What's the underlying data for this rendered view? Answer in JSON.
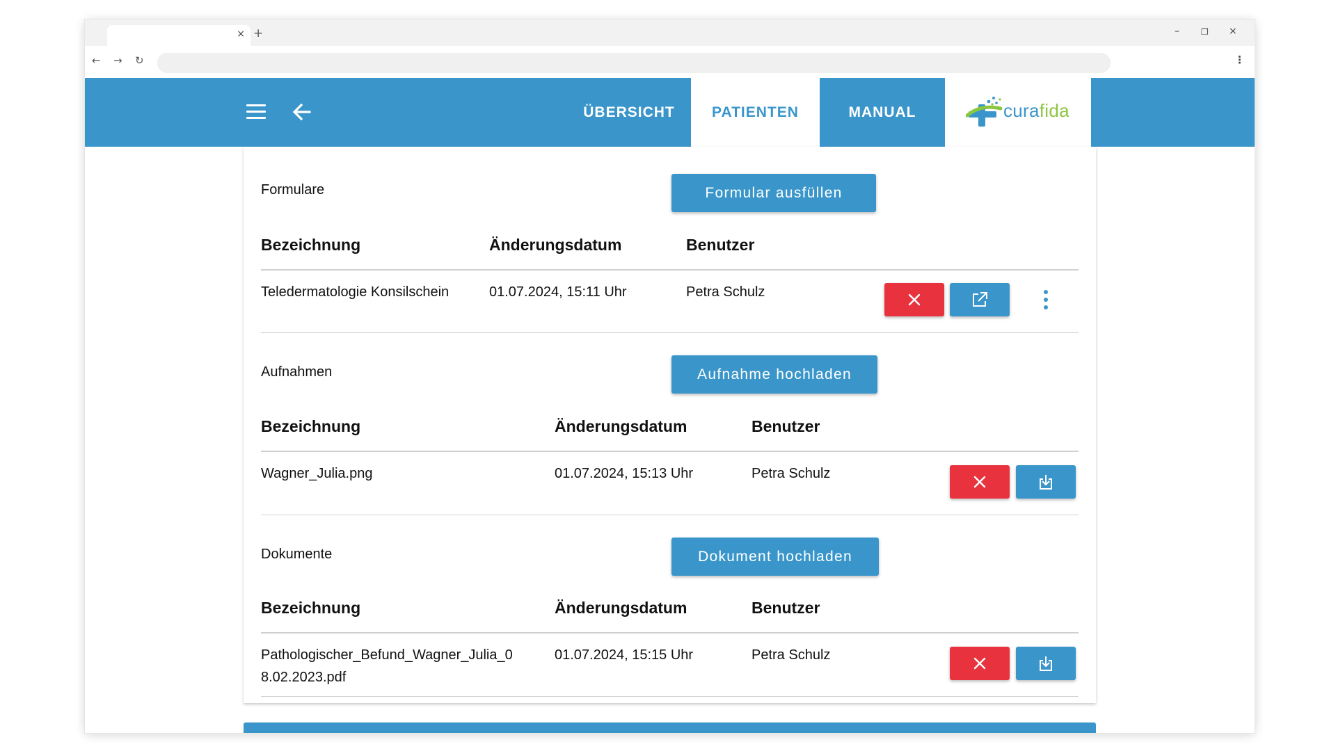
{
  "browser": {
    "tab_close": "×",
    "new_tab": "+",
    "minimize": "–",
    "restore": "❐",
    "close": "×",
    "back": "←",
    "forward": "→",
    "reload": "↻",
    "menu": "⋮",
    "address_value": ""
  },
  "appbar": {
    "nav": {
      "uebersicht": "ÜBERSICHT",
      "patienten": "PATIENTEN",
      "manual": "MANUAL"
    },
    "logo": {
      "part1": "cura",
      "part2": "fida"
    },
    "icons": {
      "menu": "menu-icon",
      "back": "arrow-left-icon"
    }
  },
  "colors": {
    "primary": "#3a96ca",
    "danger": "#e8333f",
    "logo_green": "#8cc63f"
  },
  "sections": {
    "formulare": {
      "label": "Formulare",
      "button": "Formular ausfüllen",
      "headers": [
        "Bezeichnung",
        "Änderungsdatum",
        "Benutzer"
      ],
      "rows": [
        {
          "name": "Teledermatologie Konsilschein",
          "date": "01.07.2024, 15:11 Uhr",
          "user": "Petra Schulz"
        }
      ]
    },
    "aufnahmen": {
      "label": "Aufnahmen",
      "button": "Aufnahme hochladen",
      "headers": [
        "Bezeichnung",
        "Änderungsdatum",
        "Benutzer"
      ],
      "rows": [
        {
          "name": "Wagner_Julia.png",
          "date": "01.07.2024, 15:13 Uhr",
          "user": "Petra Schulz"
        }
      ]
    },
    "dokumente": {
      "label": "Dokumente",
      "button": "Dokument hochladen",
      "headers": [
        "Bezeichnung",
        "Änderungsdatum",
        "Benutzer"
      ],
      "rows": [
        {
          "name_line1": "Pathologischer_Befund_Wagner_Julia_0",
          "name_line2": "8.02.2023.pdf",
          "date": "01.07.2024, 15:15 Uhr",
          "user": "Petra Schulz"
        }
      ]
    }
  }
}
